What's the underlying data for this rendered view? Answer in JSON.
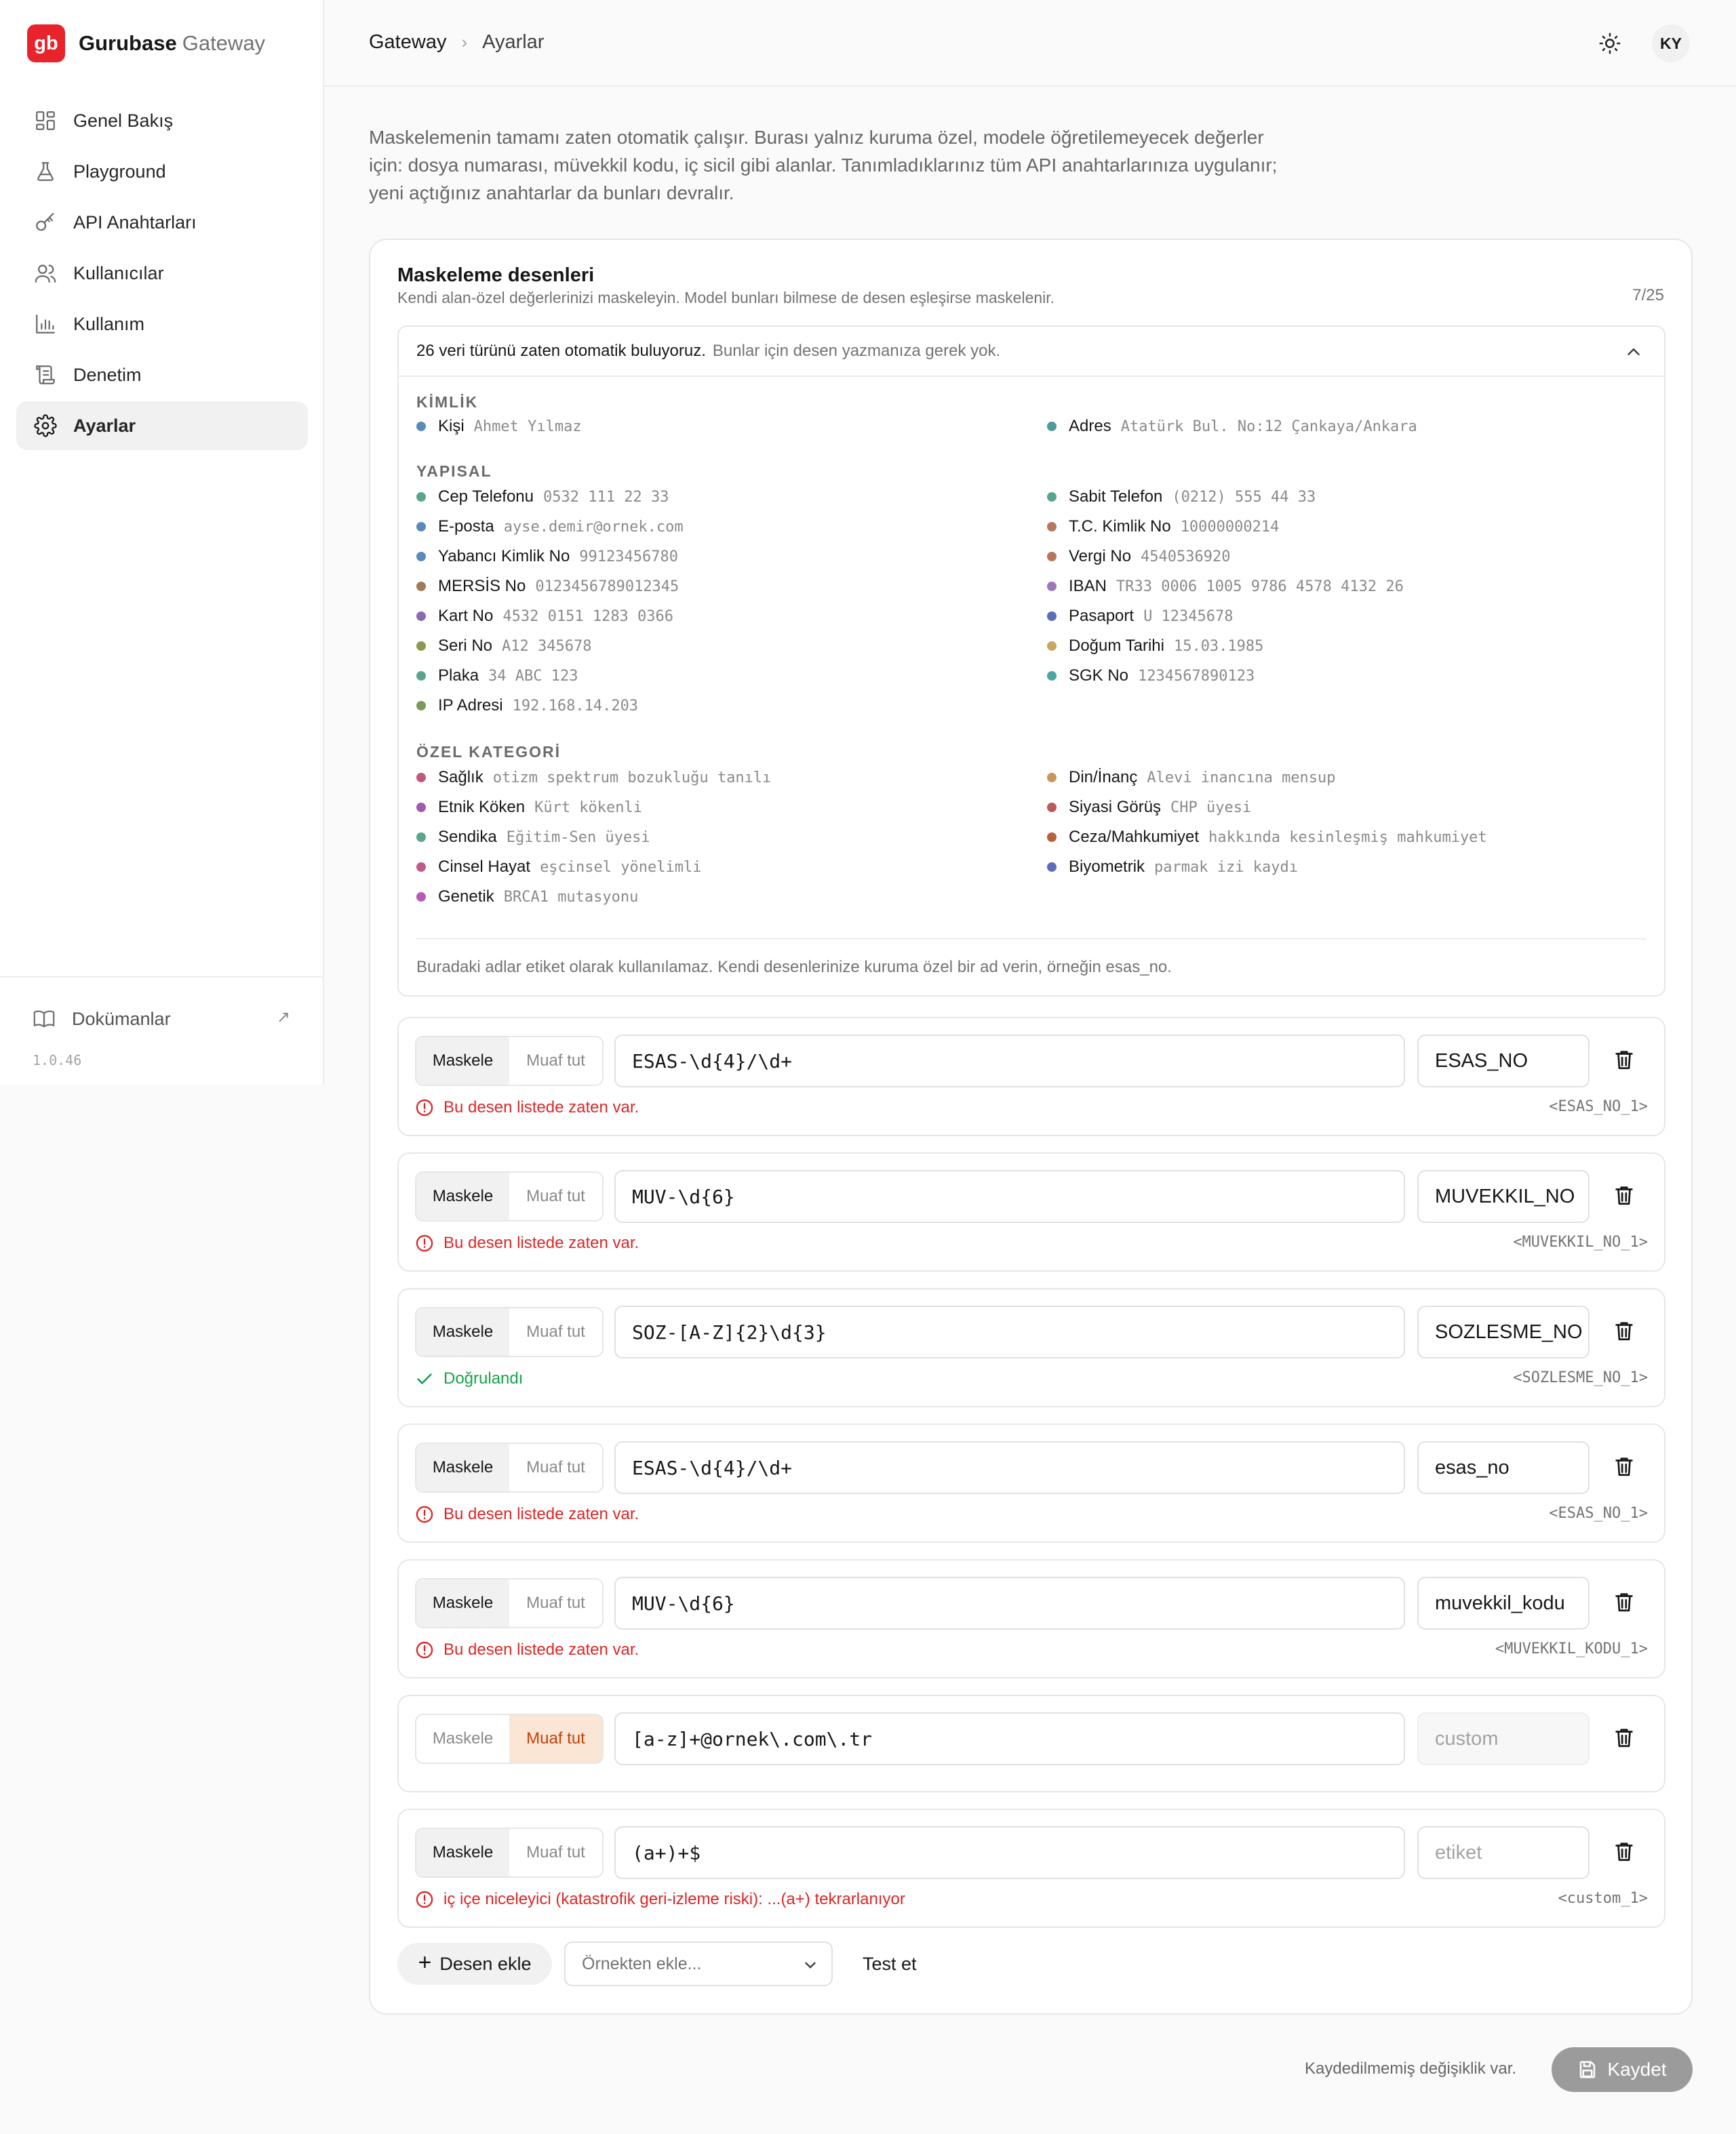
{
  "brand": {
    "name": "Gurubase",
    "sub": "Gateway",
    "logo": "gb"
  },
  "nav": [
    {
      "label": "Genel Bakış",
      "icon": "grid-icon",
      "active": false
    },
    {
      "label": "Playground",
      "icon": "flask-icon",
      "active": false
    },
    {
      "label": "API Anahtarları",
      "icon": "key-icon",
      "active": false
    },
    {
      "label": "Kullanıcılar",
      "icon": "users-icon",
      "active": false
    },
    {
      "label": "Kullanım",
      "icon": "bar-chart-icon",
      "active": false
    },
    {
      "label": "Denetim",
      "icon": "scroll-icon",
      "active": false
    },
    {
      "label": "Ayarlar",
      "icon": "gear-icon",
      "active": true
    }
  ],
  "footer": {
    "docs_label": "Dokümanlar",
    "version": "1.0.46"
  },
  "header": {
    "crumb_root": "Gateway",
    "crumb_current": "Ayarlar",
    "avatar": "KY"
  },
  "intro": "Maskelemenin tamamı zaten otomatik çalışır. Burası yalnız kuruma özel, modele öğretilemeyecek değerler için: dosya numarası, müvekkil kodu, iç sicil gibi alanlar. Tanımladıklarınız tüm API anahtarlarınıza uygulanır; yeni açtığınız anahtarlar da bunları devralır.",
  "card": {
    "title": "Maskeleme desenleri",
    "subtitle": "Kendi alan-özel değerlerinizi maskeleyin. Model bunları bilmese de desen eşleşirse maskelenir.",
    "count": "7/25"
  },
  "types": {
    "head_bold": "26 veri türünü zaten otomatik buluyoruz.",
    "head_sub": "Bunlar için desen yazmanıza gerek yok.",
    "note": "Buradaki adlar etiket olarak kullanılamaz. Kendi desenlerinize kuruma özel bir ad verin, örneğin esas_no.",
    "categories": [
      {
        "title": "KİMLİK",
        "items": [
          {
            "name": "Kişi",
            "example": "Ahmet Yılmaz",
            "color": "#5b8ab8"
          },
          {
            "name": "Adres",
            "example": "Atatürk Bul. No:12 Çankaya/Ankara",
            "color": "#4f9a9a"
          }
        ]
      },
      {
        "title": "YAPISAL",
        "items": [
          {
            "name": "Cep Telefonu",
            "example": "0532 111 22 33",
            "color": "#5aa58a"
          },
          {
            "name": "Sabit Telefon",
            "example": "(0212) 555 44 33",
            "color": "#5aa58a"
          },
          {
            "name": "E-posta",
            "example": "ayse.demir@ornek.com",
            "color": "#5b8ab8"
          },
          {
            "name": "T.C. Kimlik No",
            "example": "10000000214",
            "color": "#b8765b"
          },
          {
            "name": "Yabancı Kimlik No",
            "example": "99123456780",
            "color": "#5b8ab8"
          },
          {
            "name": "Vergi No",
            "example": "4540536920",
            "color": "#b8765b"
          },
          {
            "name": "MERSİS No",
            "example": "0123456789012345",
            "color": "#a07a5b"
          },
          {
            "name": "IBAN",
            "example": "TR33 0006 1005 9786 4578 4132 26",
            "color": "#9a7ab8"
          },
          {
            "name": "Kart No",
            "example": "4532 0151 1283 0366",
            "color": "#8a6ab0"
          },
          {
            "name": "Pasaport",
            "example": "U 12345678",
            "color": "#5b6fb8"
          },
          {
            "name": "Seri No",
            "example": "A12 345678",
            "color": "#8a9a4f"
          },
          {
            "name": "Doğum Tarihi",
            "example": "15.03.1985",
            "color": "#c8a860"
          },
          {
            "name": "Plaka",
            "example": "34 ABC 123",
            "color": "#5aa58a"
          },
          {
            "name": "SGK No",
            "example": "1234567890123",
            "color": "#4fa5a0"
          },
          {
            "name": "IP Adresi",
            "example": "192.168.14.203",
            "color": "#7a9a5b"
          }
        ]
      },
      {
        "title": "ÖZEL KATEGORİ",
        "items": [
          {
            "name": "Sağlık",
            "example": "otizm spektrum bozukluğu tanılı",
            "color": "#c05a7a"
          },
          {
            "name": "Din/İnanç",
            "example": "Alevi inancına mensup",
            "color": "#c8985b"
          },
          {
            "name": "Etnik Köken",
            "example": "Kürt kökenli",
            "color": "#a05ab0"
          },
          {
            "name": "Siyasi Görüş",
            "example": "CHP üyesi",
            "color": "#b85b5b"
          },
          {
            "name": "Sendika",
            "example": "Eğitim-Sen üyesi",
            "color": "#5aa58a"
          },
          {
            "name": "Ceza/Mahkumiyet",
            "example": "hakkında kesinleşmiş mahkumiyet",
            "color": "#b8623b"
          },
          {
            "name": "Cinsel Hayat",
            "example": "eşcinsel yönelimli",
            "color": "#c05a8a"
          },
          {
            "name": "Biyometrik",
            "example": "parmak izi kaydı",
            "color": "#5b6fb8"
          },
          {
            "name": "Genetik",
            "example": "BRCA1 mutasyonu",
            "color": "#b85ab8"
          }
        ]
      }
    ]
  },
  "mode_labels": {
    "mask": "Maskele",
    "exempt": "Muaf tut"
  },
  "patterns": [
    {
      "mode": "mask",
      "pattern": "ESAS-\\d{4}/\\d+",
      "label": "ESAS_NO",
      "label_state": "value",
      "status": "error",
      "status_text": "Bu desen listede zaten var.",
      "token": "<ESAS_NO_1>"
    },
    {
      "mode": "mask",
      "pattern": "MUV-\\d{6}",
      "label": "MUVEKKIL_NO",
      "label_state": "value",
      "status": "error",
      "status_text": "Bu desen listede zaten var.",
      "token": "<MUVEKKIL_NO_1>"
    },
    {
      "mode": "mask",
      "pattern": "SOZ-[A-Z]{2}\\d{3}",
      "label": "SOZLESME_NO",
      "label_state": "value",
      "status": "ok",
      "status_text": "Doğrulandı",
      "token": "<SOZLESME_NO_1>"
    },
    {
      "mode": "mask",
      "pattern": "ESAS-\\d{4}/\\d+",
      "label": "esas_no",
      "label_state": "value",
      "status": "error",
      "status_text": "Bu desen listede zaten var.",
      "token": "<ESAS_NO_1>"
    },
    {
      "mode": "mask",
      "pattern": "MUV-\\d{6}",
      "label": "muvekkil_kodu",
      "label_state": "value",
      "status": "error",
      "status_text": "Bu desen listede zaten var.",
      "token": "<MUVEKKIL_KODU_1>"
    },
    {
      "mode": "exempt",
      "pattern": "[a-z]+@ornek\\.com\\.tr",
      "label": "custom",
      "label_state": "disabled",
      "status": "",
      "status_text": "",
      "token": ""
    },
    {
      "mode": "mask",
      "pattern": "(a+)+$",
      "label": "etiket",
      "label_state": "placeholder",
      "status": "error",
      "status_text": "iç içe niceleyici (katastrofik geri-izleme riski): ...(a+) tekrarlanıyor",
      "token": "<custom_1>"
    }
  ],
  "actions": {
    "add": "Desen ekle",
    "example_placeholder": "Örnekten ekle...",
    "test": "Test et"
  },
  "save_bar": {
    "unsaved": "Kaydedilmemiş değişiklik var.",
    "save": "Kaydet"
  }
}
